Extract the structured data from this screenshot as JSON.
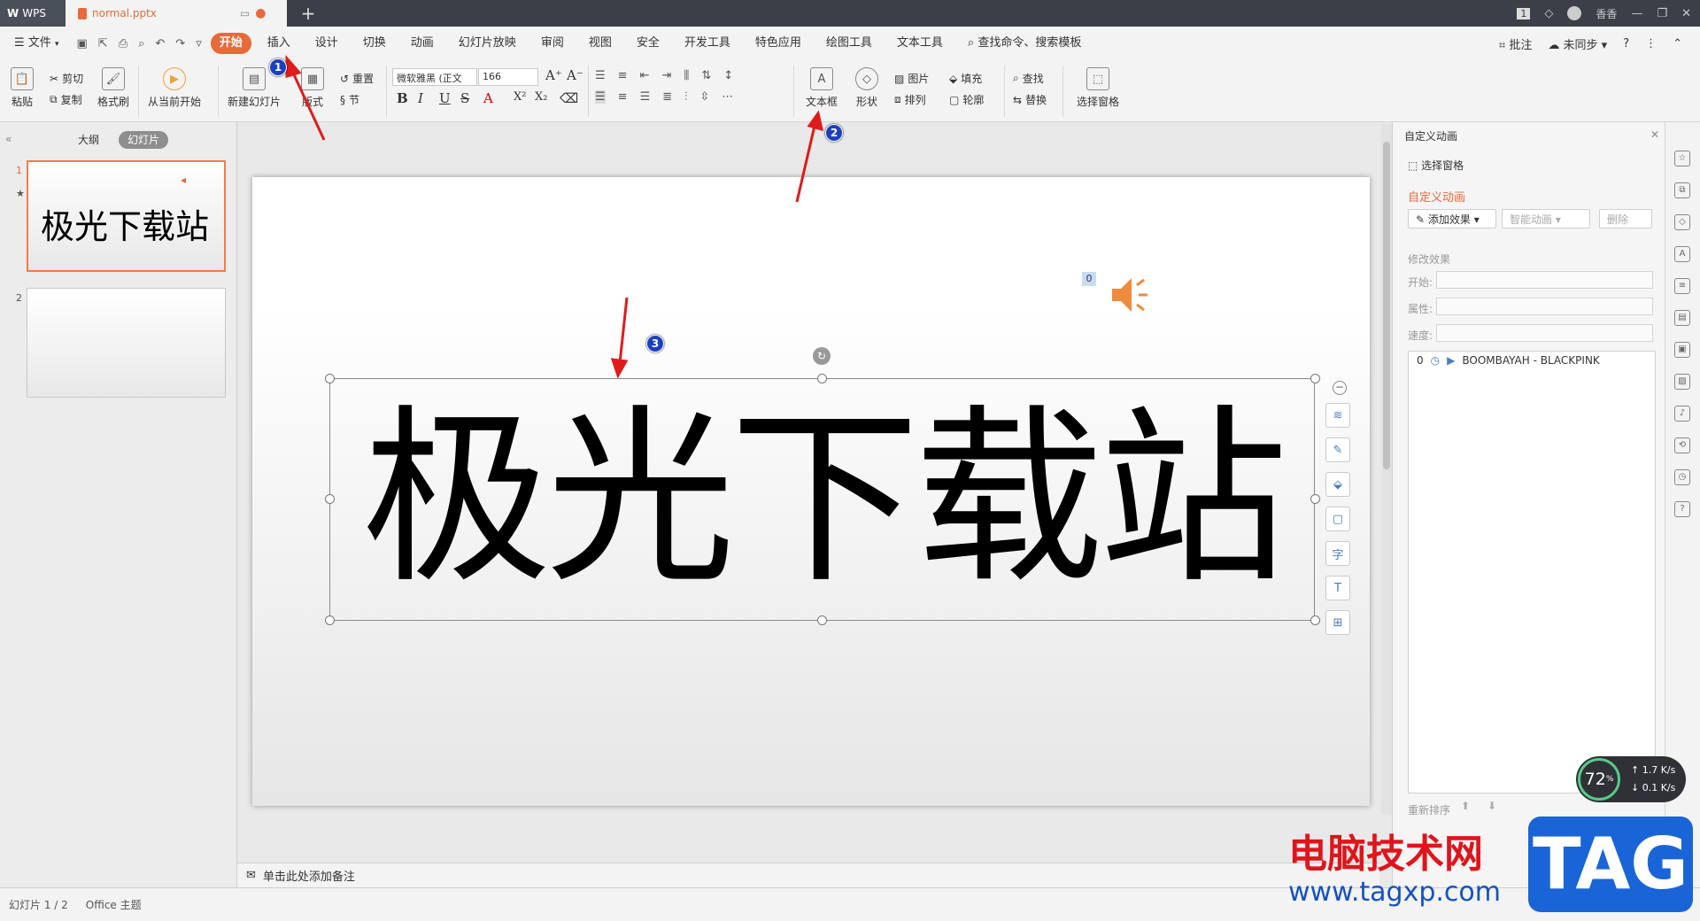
{
  "titlebar": {
    "app": "WPS",
    "doc_tab": "normal.pptx",
    "page_badge": "1",
    "user": "香香"
  },
  "menubar": {
    "file": "文件",
    "items": [
      "开始",
      "插入",
      "设计",
      "切换",
      "动画",
      "幻灯片放映",
      "审阅",
      "视图",
      "安全",
      "开发工具",
      "特色应用",
      "绘图工具",
      "文本工具"
    ],
    "search": "查找命令、搜索模板",
    "comment": "批注",
    "sync": "未同步"
  },
  "ribbon": {
    "paste": "粘贴",
    "cut": "剪切",
    "copy": "复制",
    "format_painter": "格式刷",
    "from_current": "从当前开始",
    "new_slide": "新建幻灯片",
    "layout": "版式",
    "reset": "重置",
    "section": "节",
    "font_name": "微软雅黑 (正文",
    "font_size": "166",
    "textbox": "文本框",
    "shape": "形状",
    "picture": "图片",
    "arrange": "排列",
    "fill": "填充",
    "outline": "轮廓",
    "find": "查找",
    "replace": "替换",
    "select_pane": "选择窗格"
  },
  "leftpanel": {
    "tab_outline": "大纲",
    "tab_slides": "幻灯片",
    "slide1_num": "1",
    "slide1_text": "极光下载站",
    "slide2_num": "2"
  },
  "slide": {
    "main_text": "极光下载站",
    "anim_index": "0"
  },
  "notes": {
    "placeholder": "单击此处添加备注"
  },
  "statusbar": {
    "slide_info": "幻灯片 1 / 2",
    "theme": "Office 主题"
  },
  "rightpanel": {
    "title": "自定义动画",
    "select_pane": "选择窗格",
    "section_title": "自定义动画",
    "add_effect": "添加效果",
    "smart_anim": "智能动画",
    "delete": "删除",
    "modify_title": "修改效果",
    "start_label": "开始:",
    "prop_label": "属性:",
    "speed_label": "速度:",
    "anim_item_index": "0",
    "anim_item_name": "BOOMBAYAH - BLACKPINK",
    "reorder": "重新排序"
  },
  "annotations": {
    "m1": "1",
    "m2": "2",
    "m3": "3"
  },
  "widget": {
    "percent": "72",
    "up": "1.7",
    "down": "0.1",
    "unit": "K/s"
  },
  "watermark": {
    "text": "电脑技术网",
    "url": "www.tagxp.com",
    "tag": "TAG"
  },
  "colors": {
    "accent": "#e8693a",
    "marker": "#1c3fbf",
    "arrow": "#e01b1b"
  }
}
